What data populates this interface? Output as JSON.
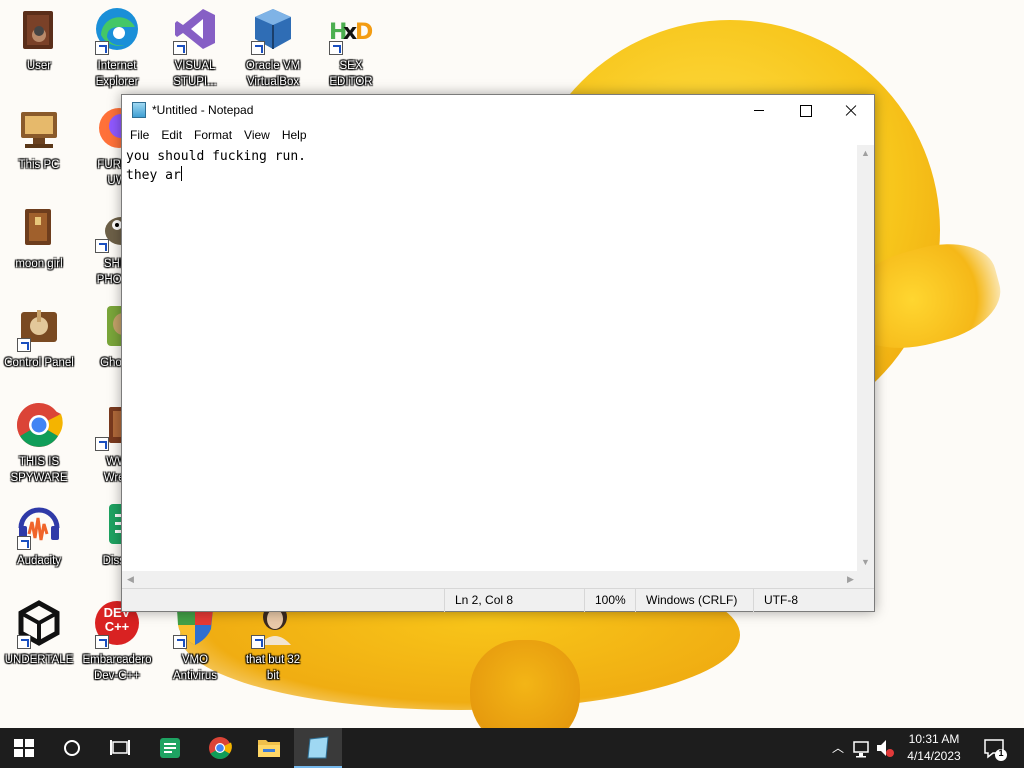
{
  "desktop": {
    "icons": [
      {
        "label": "User",
        "name": "user-folder-icon"
      },
      {
        "label": "Internet\nExplorer",
        "name": "edge-browser-icon"
      },
      {
        "label": "VISUAL\nSTUPI...",
        "name": "visual-studio-icon"
      },
      {
        "label": "Oracle VM\nVirtualBox",
        "name": "virtualbox-icon"
      },
      {
        "label": "SEX\nEDITOR",
        "name": "hex-editor-icon"
      },
      {
        "label": "This PC",
        "name": "this-pc-icon"
      },
      {
        "label": "FURRY\nUW",
        "name": "firefox-icon"
      },
      {
        "label": "moon girl",
        "name": "moon-girl-icon"
      },
      {
        "label": "SHIT\nPHOTO",
        "name": "gimp-icon"
      },
      {
        "label": "Control Panel",
        "name": "control-panel-icon"
      },
      {
        "label": "Ghomi",
        "name": "ghomi-app-icon"
      },
      {
        "label": "THIS IS\nSPYWARE",
        "name": "chrome-icon"
      },
      {
        "label": "WW\nWres",
        "name": "wrestling-app-icon"
      },
      {
        "label": "Audacity",
        "name": "audacity-icon"
      },
      {
        "label": "Disse",
        "name": "green-app-icon"
      },
      {
        "label": "UNDERTALE",
        "name": "unity-icon"
      },
      {
        "label": "Embarcadero\nDev-C++",
        "name": "dev-cpp-icon"
      },
      {
        "label": "VMO\nAntivirus",
        "name": "antivirus-shield-icon"
      },
      {
        "label": "that but 32\nbit",
        "name": "portrait-app-icon"
      }
    ],
    "devcpp_badge": "DEV\nC++",
    "hex_badge": "HxD"
  },
  "notepad": {
    "title": "*Untitled - Notepad",
    "menu": [
      "File",
      "Edit",
      "Format",
      "View",
      "Help"
    ],
    "content": "you should fucking run.\nthey ar",
    "status": {
      "position": "Ln 2, Col 8",
      "zoom": "100%",
      "line_endings": "Windows (CRLF)",
      "encoding": "UTF-8"
    }
  },
  "taskbar": {
    "time": "10:31 AM",
    "date": "4/14/2023",
    "notification_count": "1"
  },
  "colors": {
    "taskbar": "#1d1d1d",
    "accent": "#76b9ed",
    "wallpaper_yellow": "#f7c51b"
  }
}
